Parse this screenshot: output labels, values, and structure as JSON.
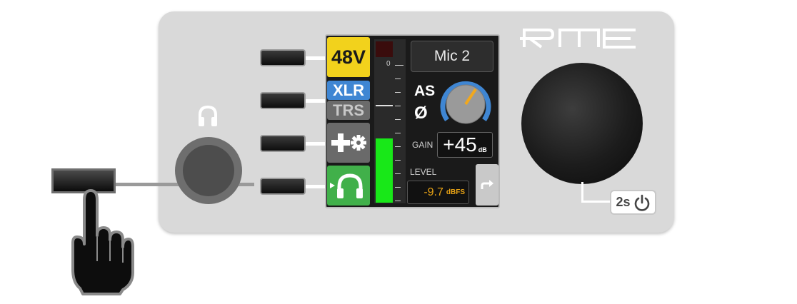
{
  "brand": {
    "logo_text": "RME"
  },
  "lcd": {
    "phantom_label": "48V",
    "input_xlr_label": "XLR",
    "input_trs_label": "TRS",
    "channel_name": "Mic 2",
    "autoset_label": "AS",
    "phase_symbol": "Ø",
    "gain_label": "GAIN",
    "gain_value": "+45",
    "gain_unit": "dB",
    "meter_zero_label": "0",
    "meter_level_fraction": 0.4,
    "level_label": "LEVEL",
    "level_value": "-9.7",
    "level_unit": "dBFS"
  },
  "power": {
    "hold_label": "2s"
  },
  "icons": {
    "headphone": "headphones-icon",
    "settings": "settings-icon",
    "monitor": "headphone-monitor-icon",
    "back": "back-arrow-icon",
    "power": "power-icon",
    "hand": "pointing-hand-icon"
  },
  "colors": {
    "phantom_tile": "#f2d21c",
    "xlr_tile": "#3f86d3",
    "trs_tile": "#6b6b6b",
    "monitor_tile": "#41b04a",
    "meter_fill": "#18e818",
    "level_text": "#e7a215",
    "knob_arc": "#3f86d3",
    "knob_pointer": "#f2a81c"
  }
}
